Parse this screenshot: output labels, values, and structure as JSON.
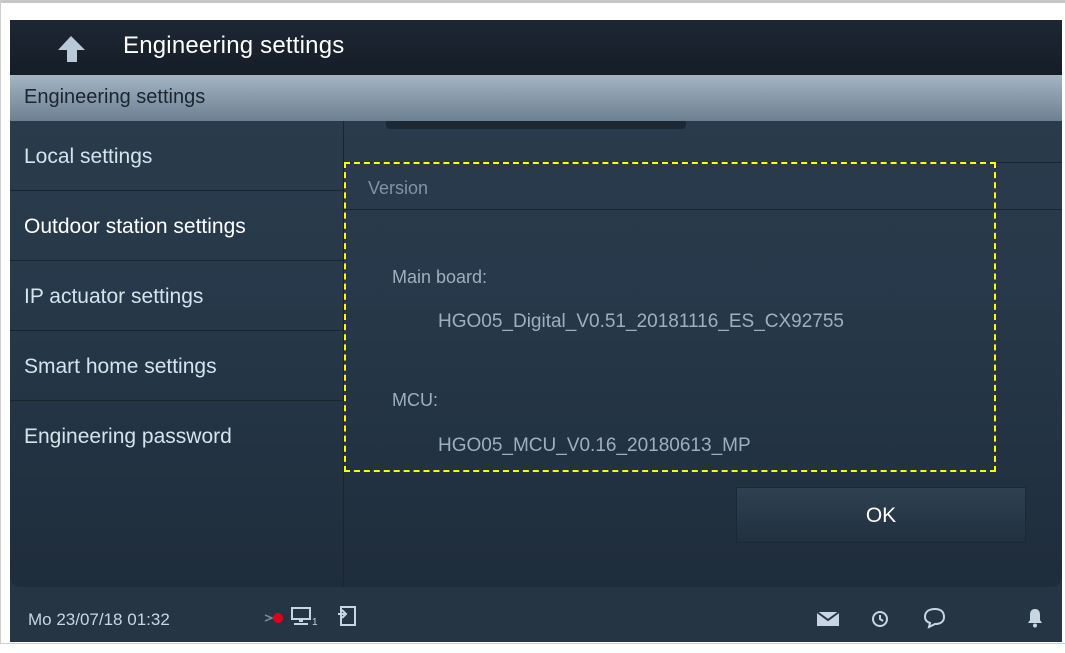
{
  "titlebar": {
    "title": "Engineering settings",
    "back_icon": "back-arrow-icon"
  },
  "panel": {
    "header": "Engineering settings"
  },
  "menu": {
    "items": [
      {
        "label": "Local settings"
      },
      {
        "label": "Outdoor station settings"
      },
      {
        "label": "IP actuator settings"
      },
      {
        "label": "Smart home settings"
      },
      {
        "label": "Engineering password"
      }
    ]
  },
  "version": {
    "section": "Version",
    "main_board_label": "Main board:",
    "main_board_value": "HGO05_Digital_V0.51_20181116_ES_CX92755",
    "mcu_label": "MCU:",
    "mcu_value": "HGO05_MCU_V0.16_20180613_MP"
  },
  "ok_button": {
    "label": "OK"
  },
  "statusbar": {
    "datetime": "Mo 23/07/18  01:32",
    "icons": [
      "record-dot-icon",
      "network-icon",
      "exit-door-icon",
      "message-envelope-icon",
      "history-clock-icon",
      "chat-bubble-icon",
      "bell-icon"
    ],
    "network_index": "1"
  },
  "colors": {
    "highlight_dash": "#ffff00",
    "record_dot": "#e0001b"
  }
}
